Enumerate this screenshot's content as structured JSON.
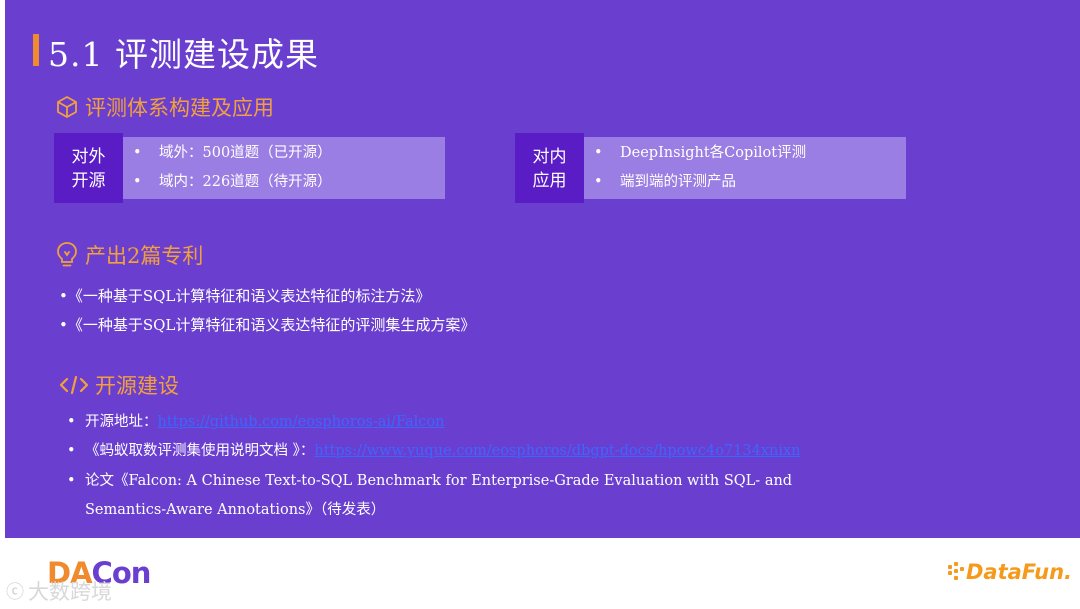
{
  "slide": {
    "title": "5.1 评测建设成果",
    "colors": {
      "background": "#6a3fd0",
      "accent": "#f08a2e",
      "heading": "#f2a03c",
      "label_box": "#5a1cc4",
      "body_box": "#9b7ee3",
      "link": "#3d66ff"
    },
    "section1": {
      "heading": "评测体系构建及应用",
      "icon": "cube-icon",
      "external": {
        "label_line1": "对外",
        "label_line2": "开源",
        "items": [
          "域外：500道题（已开源）",
          "域内：226道题（待开源）"
        ]
      },
      "internal": {
        "label_line1": "对内",
        "label_line2": "应用",
        "items": [
          "DeepInsight各Copilot评测",
          "端到端的评测产品"
        ]
      }
    },
    "section2": {
      "heading": "产出2篇专利",
      "icon": "lightbulb-icon",
      "items": [
        "•《一种基于SQL计算特征和语义表达特征的标注方法》",
        "•《一种基于SQL计算特征和语义表达特征的评测集生成方案》"
      ]
    },
    "section3": {
      "heading": "开源建设",
      "icon": "code-icon",
      "repo_prefix": "开源地址：",
      "repo_link": "https://github.com/eosphoros-ai/Falcon",
      "doc_prefix": "《蚂蚁取数评测集使用说明文档 》：",
      "doc_link": "https://www.yuque.com/eosphoros/dbgpt-docs/hpowc4o7134xnixn",
      "paper_line1": "论文《Falcon: A Chinese Text-to-SQL Benchmark for Enterprise-Grade Evaluation with SQL- and",
      "paper_line2": "Semantics-Aware Annotations》（待发表）"
    }
  },
  "footer": {
    "logo_da": "DA",
    "logo_con": "Con",
    "watermark": "大数跨境",
    "brand": "DataFun."
  }
}
